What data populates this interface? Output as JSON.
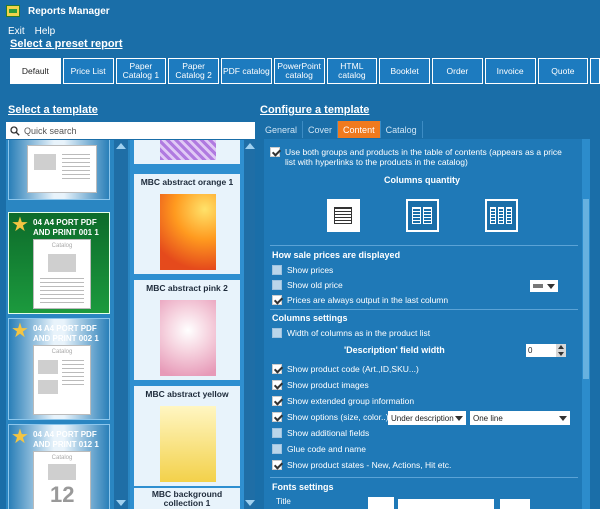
{
  "window": {
    "title": "Reports Manager"
  },
  "menu": {
    "items": [
      "Exit",
      "Help"
    ]
  },
  "preset": {
    "label": "Select a preset report",
    "tabs": [
      "Default",
      "Price List",
      "Paper\nCatalog 1",
      "Paper\nCatalog 2",
      "PDF catalog",
      "PowerPoint\ncatalog",
      "HTML catalog",
      "Booklet",
      "Order",
      "Invoice",
      "Quote"
    ],
    "active": 0
  },
  "left": {
    "title": "Select a template",
    "search": {
      "placeholder": "Quick search",
      "value": "Quick search"
    },
    "templates": [
      {
        "name": "04 A4 PORT PDF AND PRINT 001 1",
        "caption": "Catalog",
        "selected": true
      },
      {
        "name": "04 A4 PORT PDF AND PRINT 002 1",
        "caption": "Catalog",
        "selected": false
      },
      {
        "name": "04 A4 PORT PDF AND PRINT 012 1",
        "caption": "Catalog",
        "number": "12",
        "selected": false
      }
    ],
    "backgrounds": [
      {
        "name": "MBC abstract orange 1"
      },
      {
        "name": "MBC abstract pink 2"
      },
      {
        "name": "MBC abstract yellow"
      },
      {
        "name": "MBC background\ncollection 1"
      }
    ]
  },
  "right": {
    "title": "Configure a template",
    "tabs": [
      "General",
      "Cover",
      "Content",
      "Catalog"
    ],
    "active_tab": 2,
    "toc_option": "Use both groups and products in the table of contents (appears as a price list with hyperlinks to the products in the catalog)",
    "columns_quantity": "Columns quantity",
    "prices": {
      "header": "How sale prices are displayed",
      "show_prices": "Show prices",
      "show_old_price": "Show old price",
      "always_last": "Prices are always output in the last column"
    },
    "columns": {
      "header": "Columns settings",
      "width_as_list": "Width of columns as in the product list",
      "desc_width_label": "'Description' field width",
      "desc_width_value": "0"
    },
    "options": [
      {
        "label": "Show product code (Art.,ID,SKU...)",
        "checked": true
      },
      {
        "label": "Show product images",
        "checked": true
      },
      {
        "label": "Show extended group information",
        "checked": true
      },
      {
        "label": "Show options (size, color..)",
        "checked": true
      },
      {
        "label": "Show additional fields",
        "checked": false
      },
      {
        "label": "Glue code and name",
        "checked": false
      },
      {
        "label": "Show product states - New, Actions, Hit etc.",
        "checked": true
      }
    ],
    "show_options_select1": "Under description",
    "show_options_select2": "One line",
    "fonts": {
      "header": "Fonts settings",
      "title": "Title"
    }
  }
}
